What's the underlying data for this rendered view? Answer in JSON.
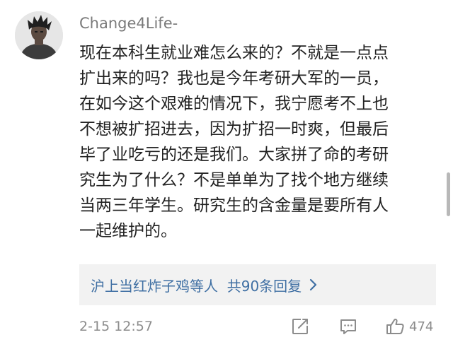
{
  "comment": {
    "username": "Change4Life-",
    "lines": [
      "现在本科生就业难怎么来的？不就是一点点",
      "扩出来的吗？我也是今年考研大军的一员，",
      "在如今这个艰难的情况下，我宁愿考不上也",
      "不想被扩招进去，因为扩招一时爽，但最后",
      "毕了业吃亏的还是我们。大家拼了命的考研",
      "究生为了什么？不是单单为了找个地方继续",
      "当两三年学生。研究生的含金量是要所有人",
      "一起维护的。"
    ],
    "replies_link": "沪上当红炸子鸡等人  共90条回复",
    "timestamp": "2-15 12:57",
    "like_count": "474"
  },
  "icons": {
    "share": "share-icon",
    "reply": "comment-icon",
    "like": "thumbs-up-icon",
    "more": "chevron-right-icon"
  },
  "colors": {
    "link": "#3f6fa3",
    "muted": "#8c8c8c",
    "reply_box_bg": "#f2f2f2"
  }
}
